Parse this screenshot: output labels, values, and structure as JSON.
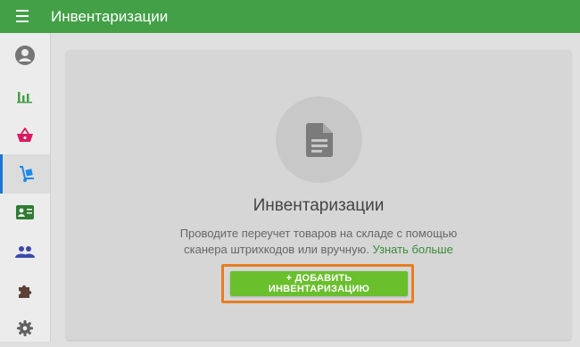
{
  "header": {
    "title": "Инвентаризации",
    "menu_icon": "hamburger-menu-icon",
    "color": "#43a047"
  },
  "sidebar": {
    "items": [
      {
        "name": "profile",
        "icon": "account-circle-icon",
        "color": "#757575"
      },
      {
        "name": "reports",
        "icon": "bar-chart-icon",
        "color": "#43a047"
      },
      {
        "name": "sales",
        "icon": "basket-icon",
        "color": "#d81b60"
      },
      {
        "name": "inventory",
        "icon": "hand-truck-icon",
        "color": "#1e88e5",
        "active": true
      },
      {
        "name": "contacts",
        "icon": "id-card-icon",
        "color": "#2e7d32"
      },
      {
        "name": "users",
        "icon": "people-icon",
        "color": "#3949ab"
      },
      {
        "name": "integrations",
        "icon": "puzzle-icon",
        "color": "#5d4037"
      },
      {
        "name": "settings",
        "icon": "gear-icon",
        "color": "#616161"
      }
    ],
    "active_accent": "#1976d2"
  },
  "empty_state": {
    "icon": "document-icon",
    "title": "Инвентаризации",
    "description_line1": "Проводите переучет товаров на складе с помощью",
    "description_line2": "сканера штрихкодов или вручную.",
    "learn_more": "Узнать больше",
    "add_button": "+ ДОБАВИТЬ ИНВЕНТАРИЗАЦИЮ",
    "button_color": "#6abf2c",
    "highlight_color": "#e67e22"
  }
}
